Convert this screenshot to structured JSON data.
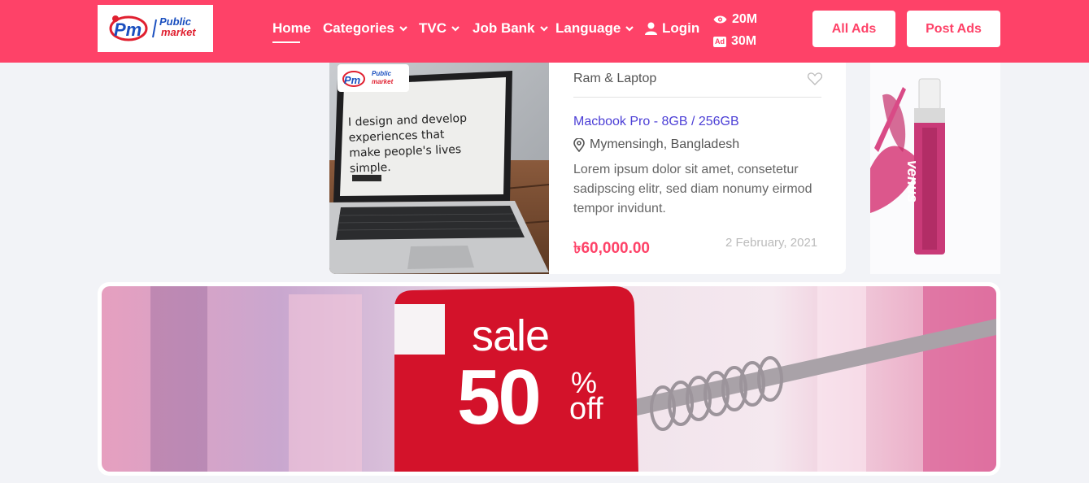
{
  "header": {
    "logo_text": "Public market",
    "nav": [
      {
        "label": "Home",
        "has_dropdown": false,
        "active": true
      },
      {
        "label": "Categories",
        "has_dropdown": true
      },
      {
        "label": "TVC",
        "has_dropdown": true
      },
      {
        "label": "Job Bank",
        "has_dropdown": true
      },
      {
        "label": "Language",
        "has_dropdown": true
      }
    ],
    "login_label": "Login",
    "views_count": "20M",
    "ads_badge": "Ad",
    "ads_count": "30M",
    "all_ads_label": "All Ads",
    "post_ads_label": "Post Ads",
    "brand_color": "#fe4268"
  },
  "listing": {
    "category": "Ram & Laptop",
    "title": "Macbook Pro - 8GB / 256GB",
    "location": "Mymensingh, Bangladesh",
    "description": "Lorem ipsum dolor sit amet, consetetur sadipscing elitr, sed diam nonumy eirmod tempor invidunt.",
    "price": "৳60,000.00",
    "date": "2 February, 2021",
    "image_text": "I design and develop experiences that make people's lives simple.",
    "title_color": "#4c3fd6"
  },
  "banner": {
    "sale_word": "sale",
    "sale_number": "50",
    "sale_percent": "%",
    "sale_off": "off"
  },
  "side_ad": {
    "brand": "venus"
  }
}
